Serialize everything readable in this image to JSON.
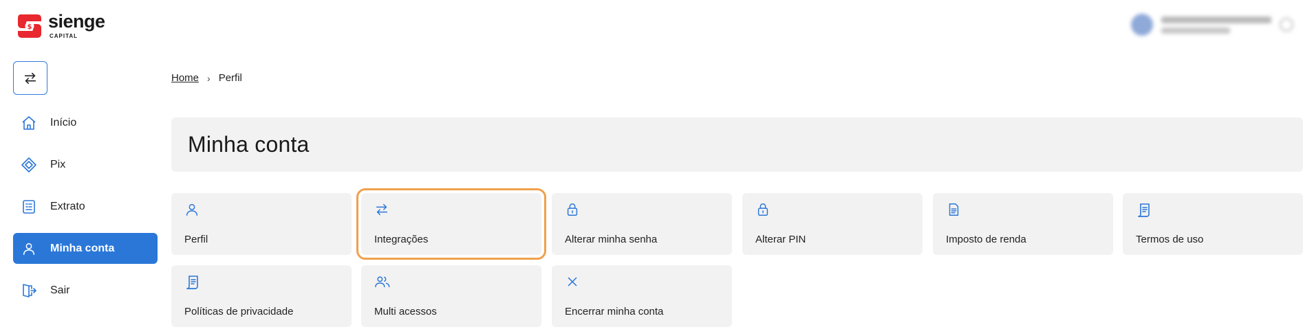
{
  "brand": {
    "name": "sienge",
    "subtitle": "CAPITAL",
    "primary_color": "#e8272e",
    "accent_color": "#2a77d8"
  },
  "sidebar": {
    "switch_icon": "arrows-swap-icon",
    "items": [
      {
        "label": "Início",
        "icon": "home-icon",
        "active": false
      },
      {
        "label": "Pix",
        "icon": "pix-icon",
        "active": false
      },
      {
        "label": "Extrato",
        "icon": "statement-icon",
        "active": false
      },
      {
        "label": "Minha conta",
        "icon": "user-icon",
        "active": true
      },
      {
        "label": "Sair",
        "icon": "logout-icon",
        "active": false
      }
    ]
  },
  "breadcrumb": {
    "home": "Home",
    "separator": "›",
    "current": "Perfil"
  },
  "page": {
    "title": "Minha conta"
  },
  "cards": [
    {
      "label": "Perfil",
      "icon": "user-icon"
    },
    {
      "label": "Integrações",
      "icon": "arrows-swap-icon",
      "highlighted": true
    },
    {
      "label": "Alterar minha senha",
      "icon": "lock-icon"
    },
    {
      "label": "Alterar PIN",
      "icon": "lock-icon"
    },
    {
      "label": "Imposto de renda",
      "icon": "document-icon"
    },
    {
      "label": "Termos de uso",
      "icon": "scroll-icon"
    },
    {
      "label": "Políticas de privacidade",
      "icon": "scroll-icon"
    },
    {
      "label": "Multi acessos",
      "icon": "users-icon"
    },
    {
      "label": "Encerrar minha conta",
      "icon": "close-icon"
    }
  ]
}
